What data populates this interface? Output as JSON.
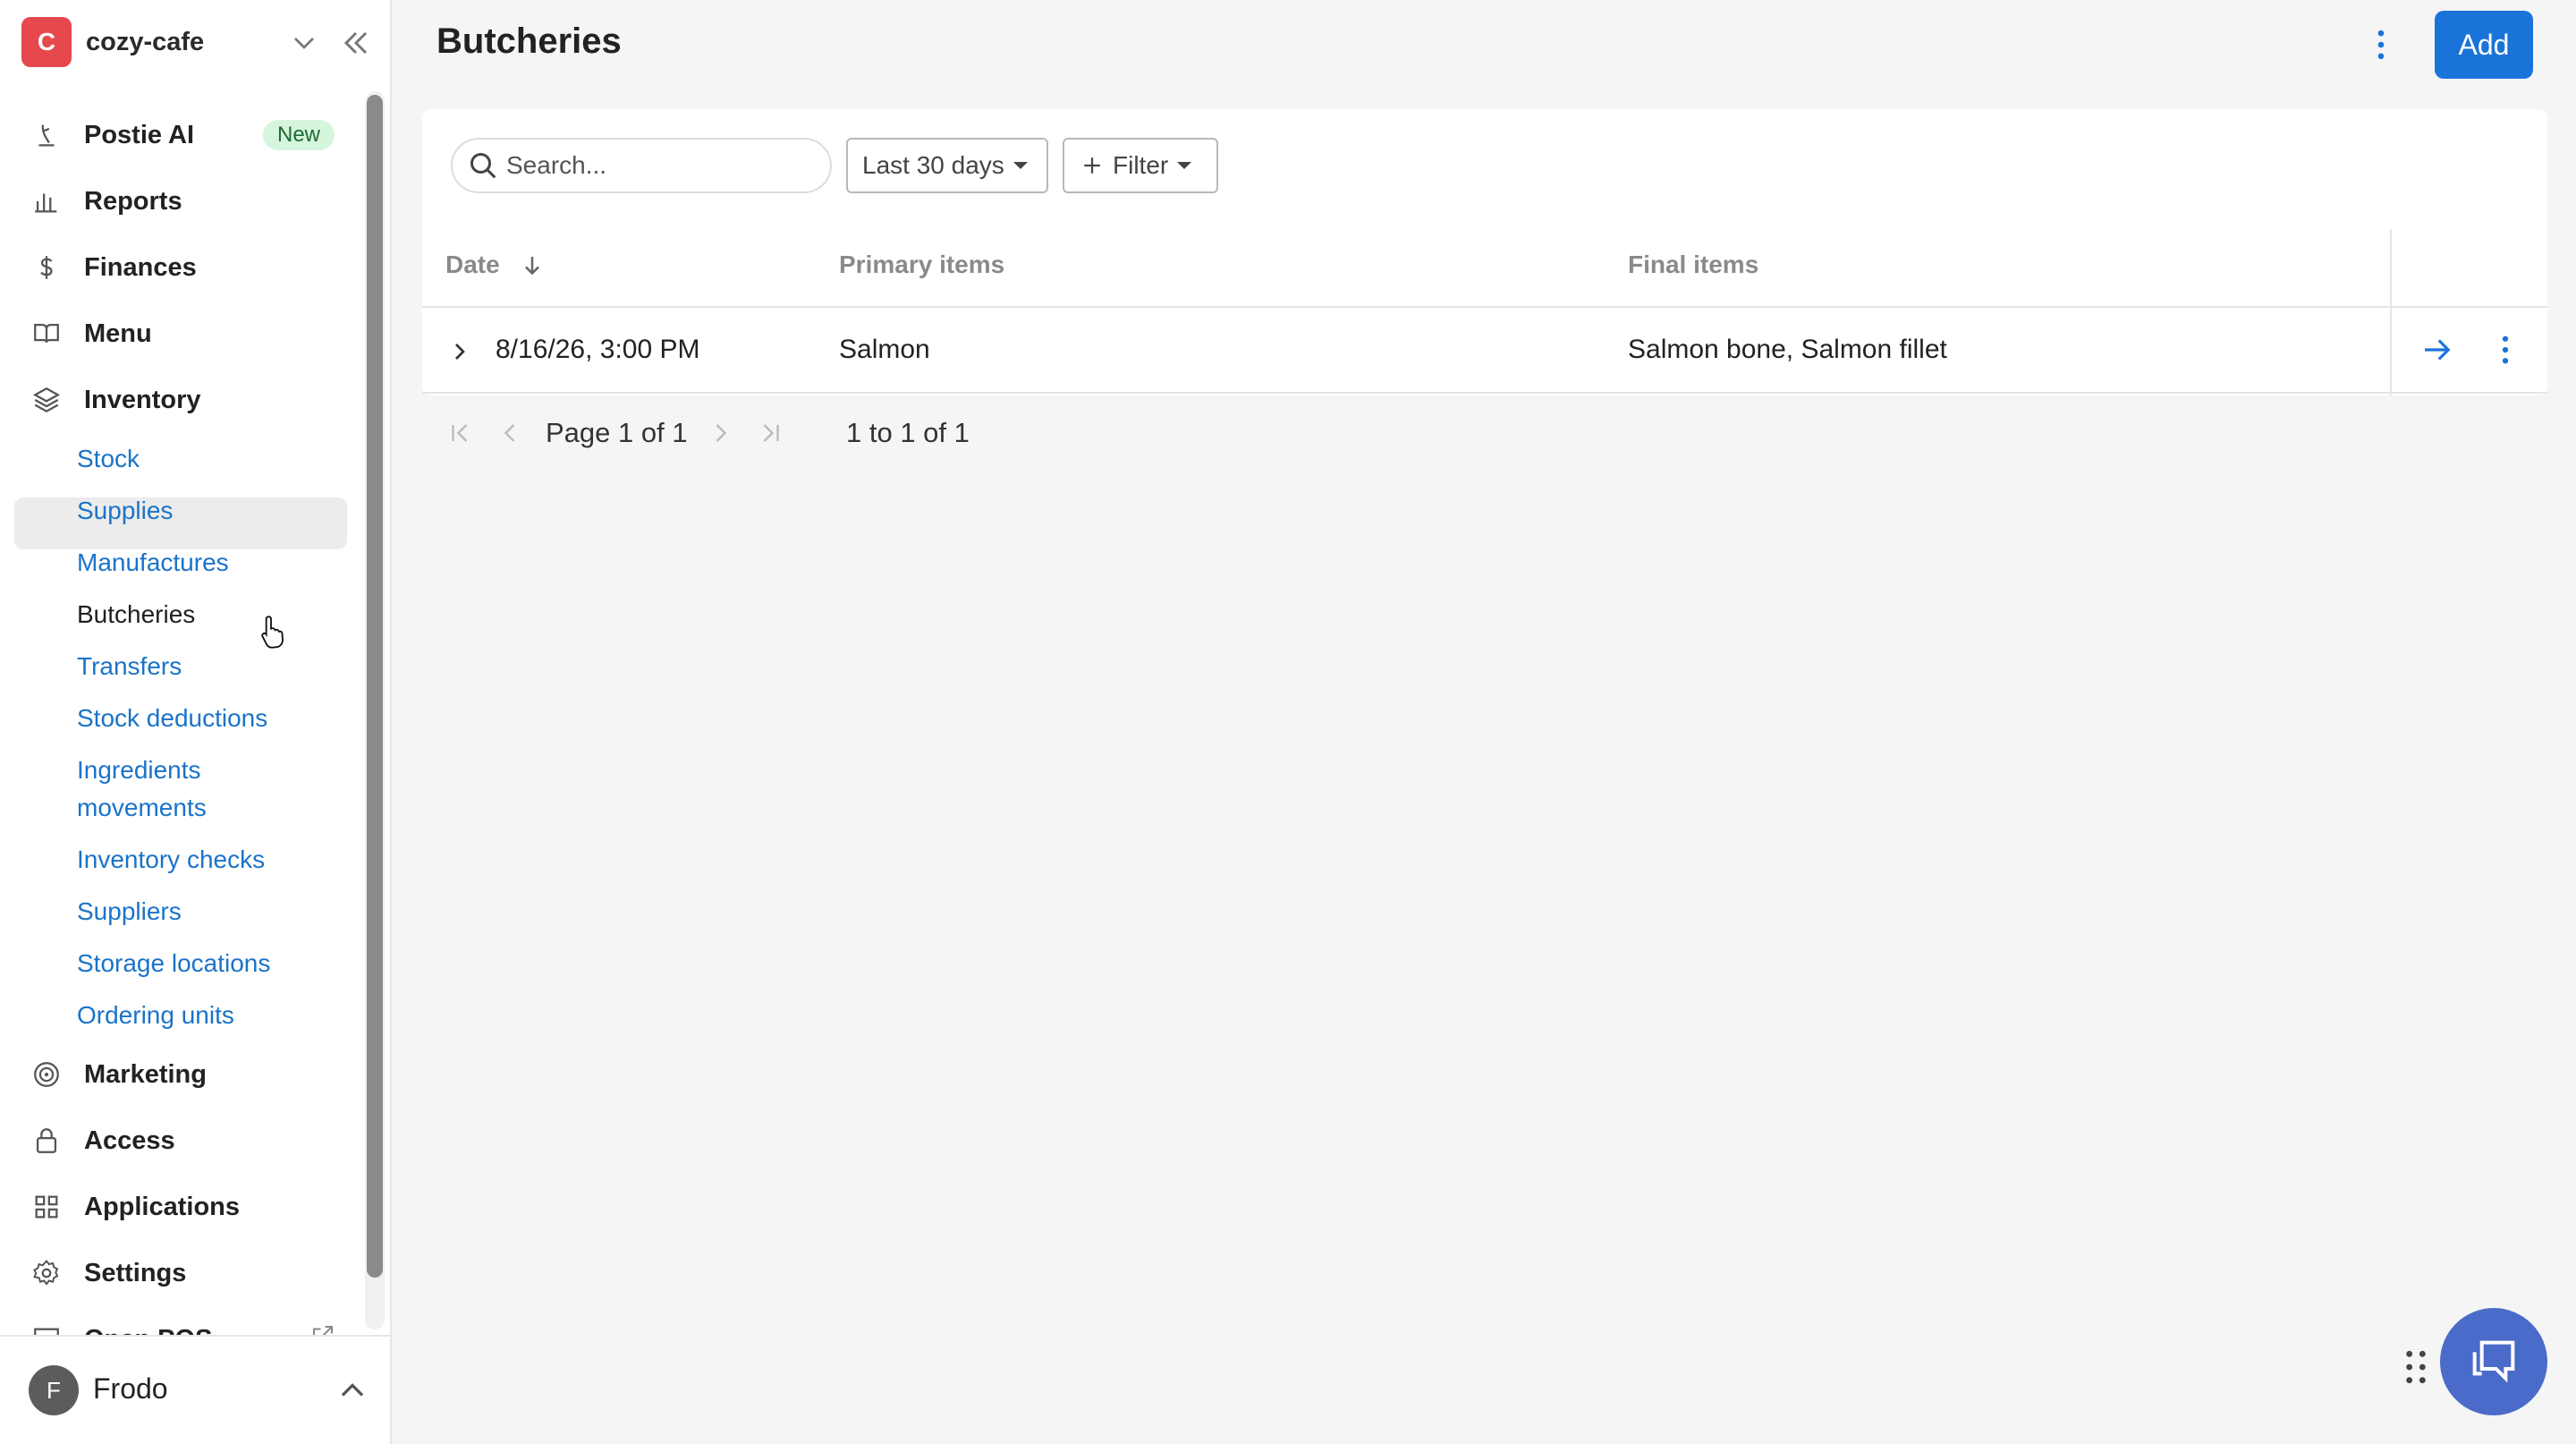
{
  "org": {
    "initial": "C",
    "name": "cozy-cafe"
  },
  "nav": {
    "postie": {
      "label": "Postie AI",
      "badge": "New"
    },
    "reports": "Reports",
    "finances": "Finances",
    "menu": "Menu",
    "inventory": "Inventory",
    "inventory_sub": {
      "stock": "Stock",
      "supplies": "Supplies",
      "manufactures": "Manufactures",
      "butcheries": "Butcheries",
      "transfers": "Transfers",
      "stock_deductions": "Stock deductions",
      "ingredients_movements_1": "Ingredients",
      "ingredients_movements_2": "movements",
      "inventory_checks": "Inventory checks",
      "suppliers": "Suppliers",
      "storage_locations": "Storage locations",
      "ordering_units": "Ordering units"
    },
    "marketing": "Marketing",
    "access": "Access",
    "applications": "Applications",
    "settings": "Settings",
    "open_pos": "Open POS"
  },
  "user": {
    "initial": "F",
    "name": "Frodo"
  },
  "header": {
    "title": "Butcheries",
    "add_label": "Add"
  },
  "toolbar": {
    "search_placeholder": "Search...",
    "range_label": "Last 30 days",
    "filter_label": "Filter"
  },
  "table": {
    "columns": {
      "date": "Date",
      "primary": "Primary items",
      "final": "Final items"
    },
    "rows": [
      {
        "date": "8/16/26, 3:00 PM",
        "primary": "Salmon",
        "final": "Salmon bone, Salmon fillet"
      }
    ]
  },
  "pagination": {
    "page_word": "Page",
    "current_page": "1",
    "of_word": "of",
    "total_pages": "1",
    "range_text": "1 to 1 of 1"
  },
  "colors": {
    "accent": "#1a73d9",
    "link": "#1a73c9",
    "org": "#e5484d",
    "badge_bg": "#d6f5dd",
    "chat": "#4a6bc9"
  }
}
